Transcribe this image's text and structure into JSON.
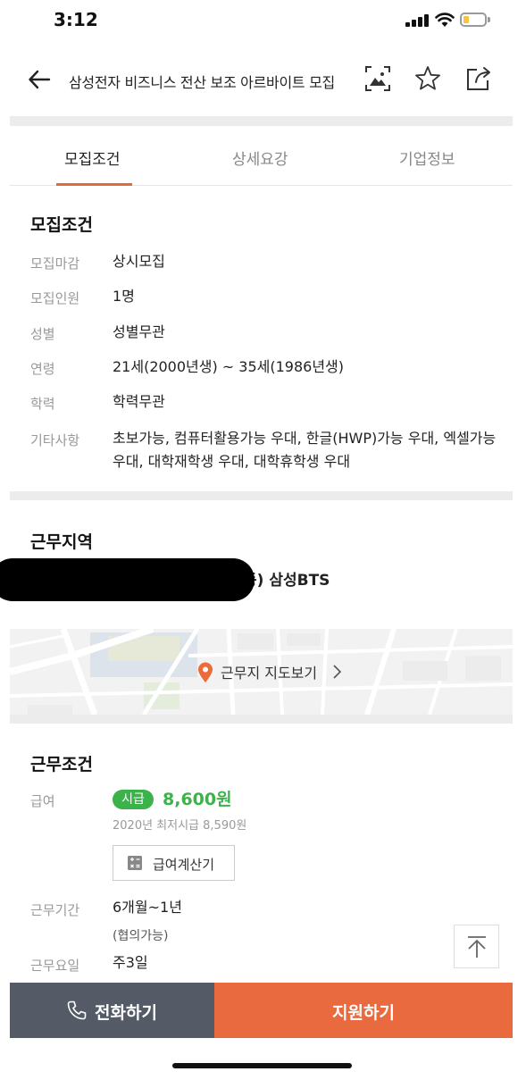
{
  "status": {
    "time": "3:12"
  },
  "header": {
    "title": "삼성전자 비즈니스 전산 보조 아르바이트 모집"
  },
  "tabs": [
    "모집조건",
    "상세요강",
    "기업정보"
  ],
  "recruit": {
    "title": "모집조건",
    "rows": [
      {
        "label": "모집마감",
        "value": "상시모집"
      },
      {
        "label": "모집인원",
        "value": "1명"
      },
      {
        "label": "성별",
        "value": "성별무관"
      },
      {
        "label": "연령",
        "value": "21세(2000년생) ~ 35세(1986년생)"
      },
      {
        "label": "학력",
        "value": "학력무관"
      },
      {
        "label": "기타사항",
        "value": "초보가능, 컴퓨터활용가능 우대, 한글(HWP)가능 우대, 엑셀가능 우대, 대학재학생 우대, 대학휴학생 우대"
      }
    ]
  },
  "location": {
    "title": "근무지역",
    "address_visible": "동) 삼성BTS",
    "map_link": "근무지 지도보기"
  },
  "conditions": {
    "title": "근무조건",
    "pay_label": "급여",
    "pay_type": "시급",
    "pay_amount": "8,600원",
    "min_wage_note": "2020년 최저시급 8,590원",
    "calc_button": "급여계산기",
    "period_label": "근무기간",
    "period_value": "6개월~1년",
    "period_note": "(협의가능)",
    "days_label": "근무요일",
    "days_value": "주3일"
  },
  "actions": {
    "call": "전화하기",
    "apply": "지원하기"
  },
  "colors": {
    "accent": "#ea6a3f",
    "pay_green": "#3cb34a",
    "call_bg": "#545b66"
  }
}
